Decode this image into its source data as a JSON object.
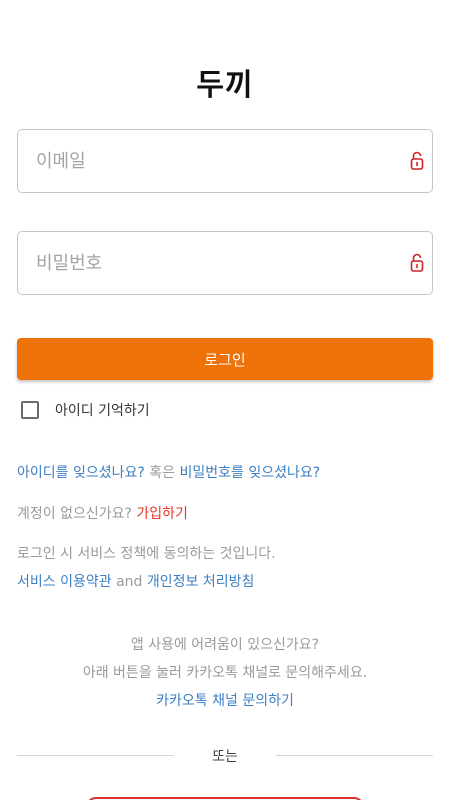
{
  "app": {
    "title": "두끼"
  },
  "form": {
    "email_placeholder": "이메일",
    "email_icon": "lock-icon",
    "password_placeholder": "비밀번호",
    "password_icon": "lock-icon",
    "login_label": "로그인",
    "remember_label": "아이디 기억하기",
    "remember_checked": false
  },
  "links": {
    "forgot_id": "아이디를 잊으셨나요?",
    "or_text": "혹은",
    "forgot_password": "비밀번호를 잊으셨나요?",
    "no_account": "계정이 없으신가요?",
    "signup": "가입하기",
    "policy_notice": "로그인 시 서비스 정책에 동의하는 것입니다.",
    "terms": "서비스 이용약관",
    "and_text": "and",
    "privacy": "개인정보 처리방침"
  },
  "help": {
    "line1": "앱 사용에 어려움이 있으신가요?",
    "line2": "아래 버튼을 눌러 카카오톡 채널로 문의해주세요.",
    "kakao_link": "카카오톡 채널 문의하기"
  },
  "separator": {
    "label": "또는"
  },
  "colors": {
    "accent": "#ee7207",
    "link": "#3e7fc2",
    "signup": "#e5352b",
    "lock_icon": "#d22222"
  }
}
